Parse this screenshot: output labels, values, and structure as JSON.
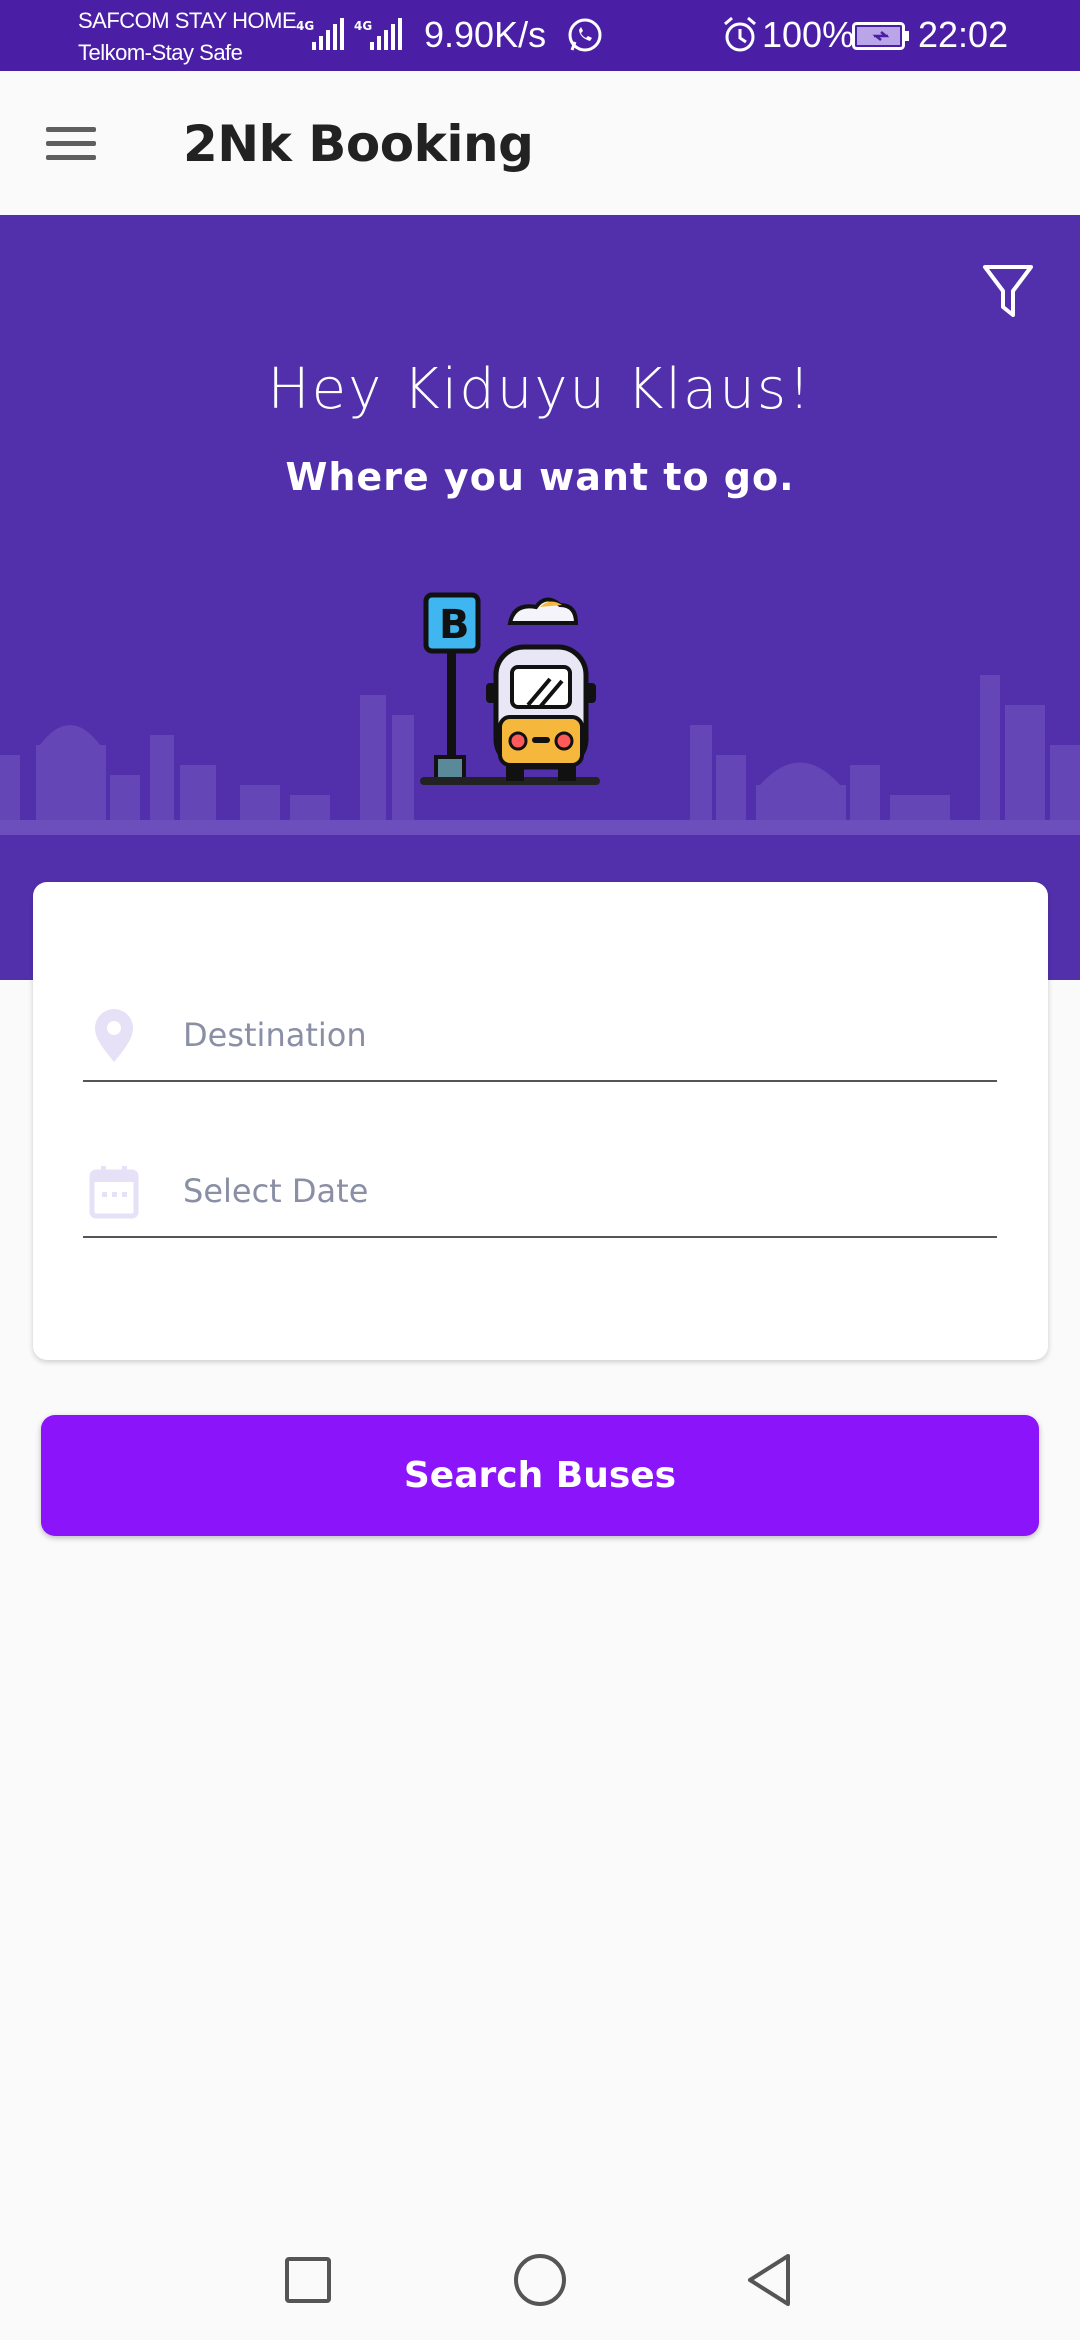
{
  "status_bar": {
    "carrier1": "SAFCOM STAY HOME",
    "carrier2": "Telkom-Stay Safe",
    "network1": "4G",
    "network2": "4G",
    "net_speed": "9.90K/s",
    "battery_percent": "100%",
    "time": "22:02",
    "icons": [
      "signal-icon",
      "whatsapp-icon",
      "alarm-icon",
      "battery-charging-icon"
    ]
  },
  "app_bar": {
    "title": "2Nk Booking",
    "menu_icon": "hamburger-menu-icon"
  },
  "hero": {
    "greeting": "Hey Kiduyu Klaus!",
    "subtitle": "Where you want to go.",
    "filter_icon": "filter-icon",
    "colors": {
      "background": "#5230ac",
      "skyline": "#6446b6"
    }
  },
  "form": {
    "destination": {
      "placeholder": "Destination",
      "value": "",
      "icon": "location-pin-icon"
    },
    "date": {
      "placeholder": "Select Date",
      "value": "",
      "icon": "calendar-icon"
    }
  },
  "actions": {
    "search_label": "Search Buses",
    "color": "#8c14fb"
  },
  "nav_bar": {
    "icons": [
      "recent-apps-icon",
      "home-icon",
      "back-icon"
    ]
  }
}
